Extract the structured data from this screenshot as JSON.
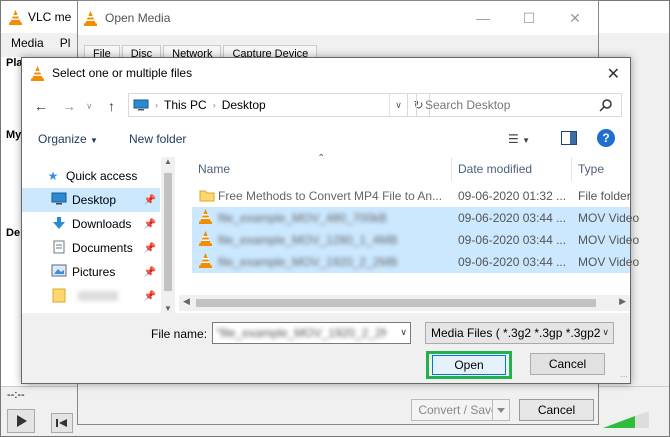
{
  "vlc": {
    "title": "VLC me",
    "menu": [
      "Media",
      "Pl"
    ],
    "sidebar": [
      "Pla",
      "My",
      "De"
    ],
    "time": "--:--"
  },
  "open_media": {
    "title": "Open Media",
    "tabs": [
      "File",
      "Disc",
      "Network",
      "Capture Device"
    ],
    "convert_label": "Convert / Save",
    "cancel_label": "Cancel"
  },
  "dialog": {
    "title": "Select one or multiple files",
    "breadcrumb": [
      "This PC",
      "Desktop"
    ],
    "search_placeholder": "Search Desktop",
    "organize_label": "Organize",
    "new_folder_label": "New folder",
    "nav": [
      {
        "label": "Quick access",
        "icon": "star-icon",
        "pinned": false
      },
      {
        "label": "Desktop",
        "icon": "desktop-icon",
        "pinned": true
      },
      {
        "label": "Downloads",
        "icon": "download-icon",
        "pinned": true
      },
      {
        "label": "Documents",
        "icon": "documents-icon",
        "pinned": true
      },
      {
        "label": "Pictures",
        "icon": "pictures-icon",
        "pinned": true
      },
      {
        "label": "",
        "icon": "folder-icon",
        "pinned": true
      }
    ],
    "columns": {
      "name": "Name",
      "date": "Date modified",
      "type": "Type"
    },
    "files": [
      {
        "name": "Free Methods to Convert MP4 File to An...",
        "date": "09-06-2020 01:32 ...",
        "type": "File folder",
        "icon": "folder-icon",
        "selected": false
      },
      {
        "name": "file_example_MOV_480_700kB",
        "date": "09-06-2020 03:44 ...",
        "type": "MOV Video",
        "icon": "vlc-cone-icon",
        "selected": true
      },
      {
        "name": "file_example_MOV_1280_1_4MB",
        "date": "09-06-2020 03:44 ...",
        "type": "MOV Video",
        "icon": "vlc-cone-icon",
        "selected": true
      },
      {
        "name": "file_example_MOV_1920_2_2MB",
        "date": "09-06-2020 03:44 ...",
        "type": "MOV Video",
        "icon": "vlc-cone-icon",
        "selected": true
      }
    ],
    "file_name_label": "File name:",
    "file_name_value": "\"file_example_MOV_1920_2_2MB\"",
    "filter": "Media Files ( *.3g2 *.3gp *.3gp2",
    "open_label": "Open",
    "cancel_label": "Cancel"
  },
  "colors": {
    "selection": "#cce8ff",
    "highlight": "#22b14c",
    "vlc_orange": "#f28c00"
  }
}
